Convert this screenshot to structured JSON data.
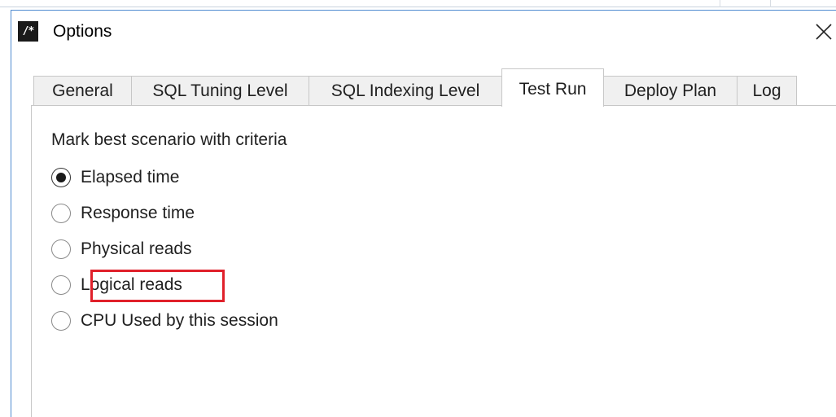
{
  "window": {
    "title": "Options",
    "icon_text": "/*",
    "close_icon": "close-icon"
  },
  "tabs": [
    {
      "label": "General",
      "active": false
    },
    {
      "label": "SQL Tuning Level",
      "active": false
    },
    {
      "label": "SQL Indexing Level",
      "active": false
    },
    {
      "label": "Test Run",
      "active": true
    },
    {
      "label": "Deploy Plan",
      "active": false
    },
    {
      "label": "Log",
      "active": false
    }
  ],
  "test_run": {
    "group_label": "Mark best scenario with criteria",
    "options": [
      {
        "label": "Elapsed time",
        "selected": true
      },
      {
        "label": "Response time",
        "selected": false
      },
      {
        "label": "Physical reads",
        "selected": false
      },
      {
        "label": "Logical reads",
        "selected": false,
        "highlighted": true
      },
      {
        "label": "CPU Used by this session",
        "selected": false
      }
    ]
  },
  "colors": {
    "window_border": "#4f8bd0",
    "highlight": "#e0202a",
    "tab_inactive_bg": "#f0f0f0"
  }
}
